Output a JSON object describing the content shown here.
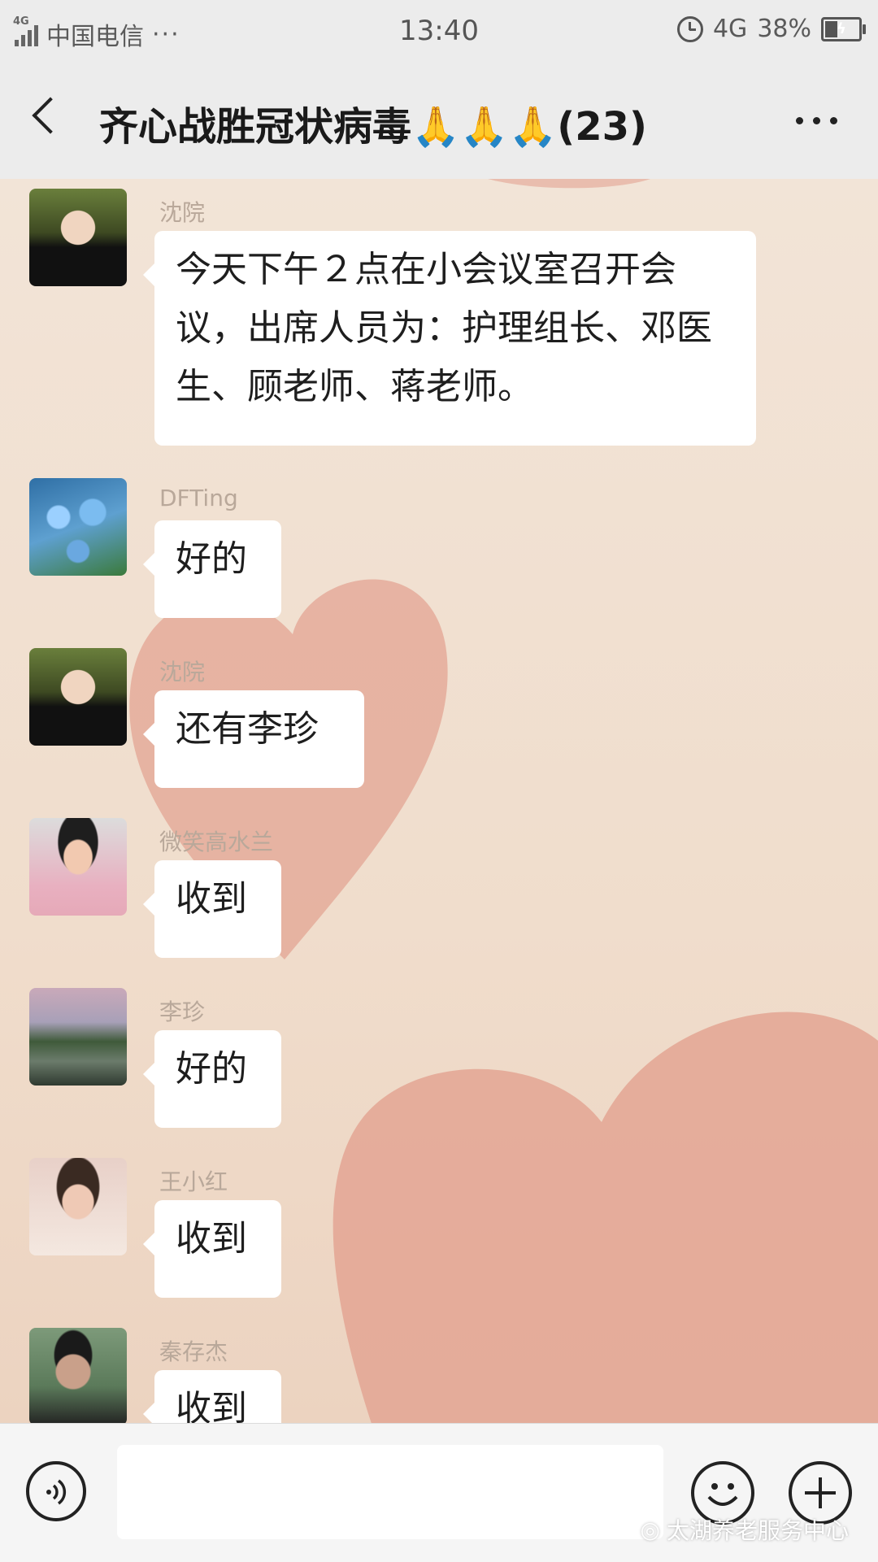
{
  "status_bar": {
    "network_type": "4G",
    "carrier": "中国电信",
    "dots": "···",
    "time": "13:40",
    "network": "4G",
    "battery": "38%",
    "battery_level": 0.38,
    "icons": [
      "signal-icon",
      "alarm-icon",
      "battery-icon"
    ]
  },
  "nav": {
    "title": "齐心战胜冠状病毒🙏🙏🙏(23)",
    "icons": [
      "back-icon",
      "more-icon"
    ]
  },
  "messages": [
    {
      "sender": "沈院",
      "text": "今天下午２点在小会议室召开会议，出席人员为：护理组长、邓医生、顾老师、蒋老师。",
      "avatar": "avatar-1"
    },
    {
      "sender": "DFTing",
      "text": "好的",
      "avatar": "avatar-2"
    },
    {
      "sender": "沈院",
      "text": "还有李珍",
      "avatar": "avatar-1"
    },
    {
      "sender": "微笑高水兰",
      "text": "收到",
      "avatar": "avatar-3"
    },
    {
      "sender": "李珍",
      "text": "好的",
      "avatar": "avatar-4"
    },
    {
      "sender": "王小红",
      "text": "收到",
      "avatar": "avatar-5"
    },
    {
      "sender": "秦存杰",
      "text": "收到",
      "avatar": "avatar-6"
    }
  ],
  "input_bar": {
    "icons": [
      "voice-icon",
      "emoji-icon",
      "plus-icon"
    ],
    "watermark": "太湖养老服务中心"
  },
  "colors": {
    "chat_background": "#f1e0d2",
    "heart": "#e3a493",
    "bubble": "#ffffff",
    "bar": "#ececec"
  }
}
